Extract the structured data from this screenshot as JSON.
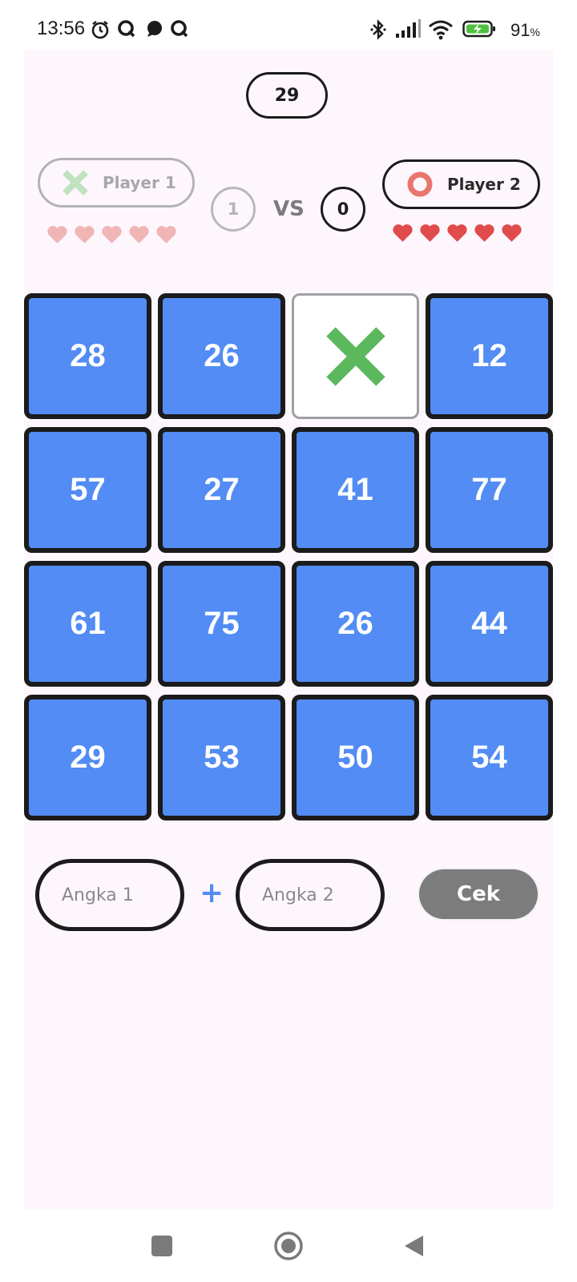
{
  "status_bar": {
    "time": "13:56",
    "battery_percent": "91",
    "battery_unit": "%",
    "icons": [
      "alarm-icon",
      "q-app-icon",
      "chat-bubble-icon",
      "q-app-icon",
      "bluetooth-icon",
      "signal-icon",
      "wifi-icon",
      "battery-charging-icon"
    ]
  },
  "game": {
    "timer": "29",
    "player1": {
      "name": "Player 1",
      "symbol": "x-icon",
      "score": "1",
      "hearts": 5
    },
    "player2": {
      "name": "Player 2",
      "symbol": "circle-icon",
      "score": "0",
      "hearts": 5
    },
    "vs_label": "VS",
    "grid": [
      [
        "28",
        "26",
        "X",
        "12"
      ],
      [
        "57",
        "27",
        "41",
        "77"
      ],
      [
        "61",
        "75",
        "26",
        "44"
      ],
      [
        "29",
        "53",
        "50",
        "54"
      ]
    ],
    "marked_cells": [
      {
        "row": 0,
        "col": 2,
        "mark": "X"
      }
    ]
  },
  "inputs": {
    "angka1_placeholder": "Angka 1",
    "angka2_placeholder": "Angka 2",
    "plus": "+",
    "check_label": "Cek"
  },
  "colors": {
    "tile_blue": "#528cf4",
    "mark_green": "#5cb85c",
    "heart_red": "#e04b4b",
    "heart_faded": "#f0b5b5",
    "player2_circle": "#e8766c",
    "button_gray": "#7c7c7c"
  },
  "nav_bar": [
    "recents-button",
    "home-button",
    "back-button"
  ]
}
